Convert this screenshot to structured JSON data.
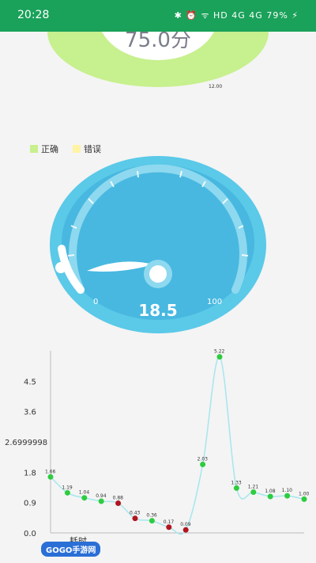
{
  "status": {
    "time": "20:28",
    "icons": "✱ ⏰ ᯤ HD 4G 4G 79% ⚡"
  },
  "score": "75.0分",
  "donut": {
    "label": "12.00",
    "correct_color": "#c7f08e",
    "wrong_color": "#fff3a6"
  },
  "legend": [
    {
      "label": "正确",
      "color": "#c7f08e"
    },
    {
      "label": "错误",
      "color": "#fff3a6"
    }
  ],
  "gauge": {
    "value": "18.5",
    "min": "0",
    "max": "100",
    "fraction": 0.185
  },
  "chart_data": {
    "type": "line",
    "title": "",
    "xlabel": "耗时",
    "ylabel": "",
    "ylim": [
      0,
      5.4
    ],
    "y_ticks": [
      "0.0",
      "0.9",
      "1.8",
      "2.6999998",
      "3.6",
      "4.5"
    ],
    "points": [
      {
        "x": 1,
        "y": 1.66,
        "label": "1.66",
        "color": "#2ecc40"
      },
      {
        "x": 2,
        "y": 1.19,
        "label": "1.19",
        "color": "#2ecc40"
      },
      {
        "x": 3,
        "y": 1.04,
        "label": "1.04",
        "color": "#2ecc40"
      },
      {
        "x": 4,
        "y": 0.94,
        "label": "0.94",
        "color": "#2ecc40"
      },
      {
        "x": 5,
        "y": 0.88,
        "label": "0.88",
        "color": "#b0151f"
      },
      {
        "x": 6,
        "y": 0.43,
        "label": "0.43",
        "color": "#b0151f"
      },
      {
        "x": 7,
        "y": 0.36,
        "label": "0.36",
        "color": "#2ecc40"
      },
      {
        "x": 8,
        "y": 0.17,
        "label": "0.17",
        "color": "#b0151f"
      },
      {
        "x": 9,
        "y": 0.09,
        "label": "0.09",
        "color": "#b0151f"
      },
      {
        "x": 10,
        "y": 2.03,
        "label": "2.03",
        "color": "#2ecc40"
      },
      {
        "x": 11,
        "y": 5.22,
        "label": "5.22",
        "color": "#2ecc40"
      },
      {
        "x": 12,
        "y": 1.33,
        "label": "1.33",
        "color": "#2ecc40"
      },
      {
        "x": 13,
        "y": 1.21,
        "label": "1.21",
        "color": "#2ecc40"
      },
      {
        "x": 14,
        "y": 1.08,
        "label": "1.08",
        "color": "#2ecc40"
      },
      {
        "x": 15,
        "y": 1.1,
        "label": "1.10",
        "color": "#2ecc40"
      },
      {
        "x": 16,
        "y": 1.0,
        "label": "1.00",
        "color": "#2ecc40"
      }
    ],
    "line_color": "#a6e6ee"
  },
  "watermark": "GOGO手游网"
}
